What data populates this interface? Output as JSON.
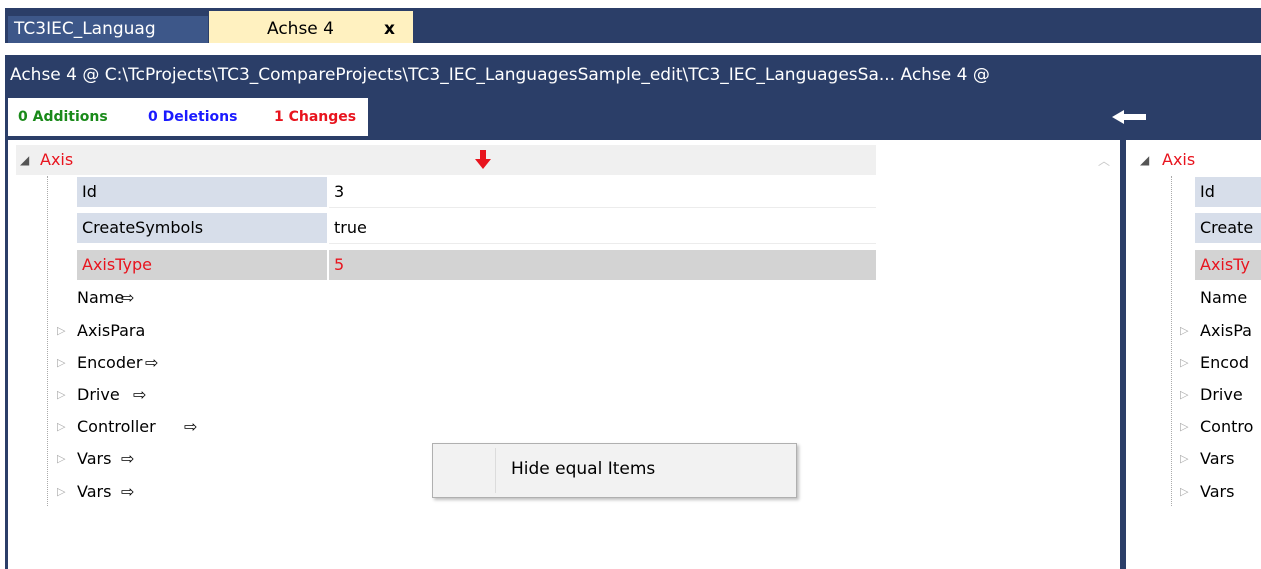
{
  "tabs": [
    {
      "label": "TC3IEC_Languag"
    },
    {
      "label": "Achse 4",
      "close": "x"
    }
  ],
  "path": "Achse 4   @ C:\\TcProjects\\TC3_CompareProjects\\TC3_IEC_LanguagesSample_edit\\TC3_IEC_LanguagesSa... Achse 4   @",
  "stats": {
    "additions": "0 Additions",
    "deletions": "0 Deletions",
    "changes": "1 Changes"
  },
  "colors": {
    "additions": "#1a8a1a",
    "deletions": "#1a1aff",
    "changes": "#e8141e",
    "frame": "#2b3e68",
    "active_tab": "#fff1c0"
  },
  "icons": {
    "expanded": "◢",
    "collapsed": "▷",
    "nav_arrow": "⇨",
    "down_red_arrow": "red-down-arrow",
    "left_arrow": "left-arrow"
  },
  "left_tree": {
    "root": "Axis",
    "props": [
      {
        "key": "Id",
        "value": "3",
        "changed": false
      },
      {
        "key": "CreateSymbols",
        "value": "true",
        "changed": false
      },
      {
        "key": "AxisType",
        "value": "5",
        "changed": true
      }
    ],
    "children": [
      {
        "label": "Name",
        "arrow": "⇨",
        "expandable": false
      },
      {
        "label": "AxisPara",
        "arrow": "",
        "expandable": true
      },
      {
        "label": "Encoder",
        "arrow": "⇨",
        "expandable": true
      },
      {
        "label": "Drive",
        "arrow": "⇨",
        "expandable": true
      },
      {
        "label": "Controller",
        "arrow": "⇨",
        "expandable": true
      },
      {
        "label": "Vars",
        "arrow": "⇨",
        "expandable": true
      },
      {
        "label": "Vars",
        "arrow": "⇨",
        "expandable": true
      }
    ]
  },
  "right_tree": {
    "root": "Axis",
    "props": [
      {
        "key": "Id",
        "changed": false
      },
      {
        "key": "Create",
        "changed": false
      },
      {
        "key": "AxisTy",
        "changed": true
      }
    ],
    "children": [
      {
        "label": "Name",
        "expandable": false
      },
      {
        "label": "AxisPa",
        "expandable": true
      },
      {
        "label": "Encod",
        "expandable": true
      },
      {
        "label": "Drive",
        "expandable": true
      },
      {
        "label": "Contro",
        "expandable": true
      },
      {
        "label": "Vars",
        "expandable": true
      },
      {
        "label": "Vars",
        "expandable": true
      }
    ]
  },
  "context_menu": {
    "items": [
      "Hide equal Items"
    ]
  }
}
